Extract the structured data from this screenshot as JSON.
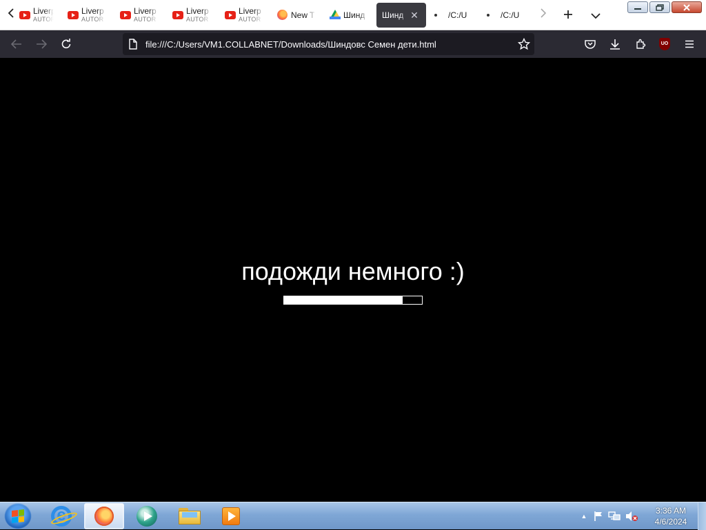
{
  "browser": {
    "tabs": [
      {
        "title": "Liverp",
        "subtitle": "AUTOR",
        "icon": "youtube-icon"
      },
      {
        "title": "Liverp",
        "subtitle": "AUTOR",
        "icon": "youtube-icon"
      },
      {
        "title": "Liverp",
        "subtitle": "AUTOR",
        "icon": "youtube-icon"
      },
      {
        "title": "Liverp",
        "subtitle": "AUTOR",
        "icon": "youtube-icon"
      },
      {
        "title": "Liverp",
        "subtitle": "AUTOR",
        "icon": "youtube-icon"
      },
      {
        "title": "New T",
        "icon": "firefox-icon"
      },
      {
        "title": "Шинд",
        "icon": "google-drive-icon"
      },
      {
        "title": "Шинд",
        "active": true
      },
      {
        "title": "/C:/U"
      },
      {
        "title": "/C:/U"
      }
    ],
    "tab_close_glyph": "✕",
    "url": "file:///C:/Users/VM1.COLLABNET/Downloads/Шиндовс Семен дети.html",
    "toolbar_icons": [
      "pocket-icon",
      "downloads-icon",
      "extensions-icon",
      "ublock-origin-icon",
      "menu-icon"
    ],
    "ublock_label": "UO"
  },
  "page": {
    "message": "подожди немного :)",
    "progress_percent": 86
  },
  "taskbar": {
    "apps": [
      "internet-explorer-icon",
      "firefox-icon",
      "media-player-icon",
      "file-explorer-icon",
      "windows-media-center-icon"
    ],
    "active_app": "firefox-icon",
    "tray_icons": [
      "show-hidden-icons-icon",
      "action-center-flag-icon",
      "network-icon",
      "volume-muted-icon"
    ],
    "clock_time": "3:36 AM",
    "clock_date": "4/6/2024"
  },
  "colors": {
    "tab_strip_bg": "#ffffff",
    "nav_bar_bg": "#2b2a33",
    "url_field_bg": "#1c1b22",
    "page_bg": "#000000",
    "progress_fill": "#ffffff"
  }
}
